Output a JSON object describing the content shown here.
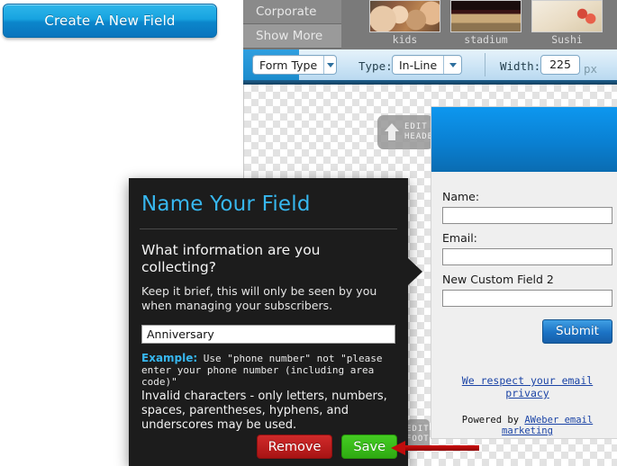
{
  "left_panel": {
    "create_button_label": "Create A New Field"
  },
  "gallery": {
    "menu_items": [
      {
        "label": "Corporate"
      },
      {
        "label": "Show More"
      }
    ],
    "thumbnails": [
      {
        "caption": "kids"
      },
      {
        "caption": "stadium"
      },
      {
        "caption": "Sushi"
      }
    ]
  },
  "toolbar": {
    "form_type_label": "Form Type",
    "type_label": "Type:",
    "type_value": "In-Line",
    "width_label": "Width:",
    "width_value": "225",
    "width_unit": "px"
  },
  "canvas": {
    "edit_header_line1": "EDIT",
    "edit_header_line2": "HEADER",
    "edit_footer_line1": "EDIT",
    "edit_footer_line2": "FOOTER"
  },
  "form_preview": {
    "fields": [
      {
        "label": "Name:",
        "value": ""
      },
      {
        "label": "Email:",
        "value": ""
      },
      {
        "label": "New Custom Field 2",
        "value": ""
      }
    ],
    "submit_label": "Submit",
    "privacy_link": "We respect your email privacy",
    "powered_prefix": "Powered by ",
    "powered_link": "AWeber email marketing"
  },
  "dialog": {
    "title": "Name Your Field",
    "question": "What information are you collecting?",
    "subtitle": "Keep it brief, this will only be seen by you when managing your subscribers.",
    "input_value": "Anniversary",
    "example_label": "Example:",
    "example_text": " Use \"phone number\" not \"please enter your phone number (including area code)\"",
    "invalid_text": "Invalid characters - only letters, numbers, spaces, parentheses, hyphens, and underscores may be used.",
    "remove_label": "Remove",
    "save_label": "Save"
  },
  "colors": {
    "accent_blue": "#37b7ef",
    "dialog_bg": "#1c1c1c",
    "save_green": "#2faa12",
    "remove_red": "#a81414",
    "annotation_red": "#c00d0d",
    "banner_blue": "#0d97ef"
  }
}
